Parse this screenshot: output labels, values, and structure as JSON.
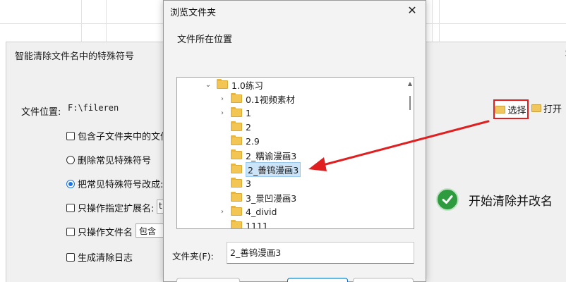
{
  "tool": {
    "title": "智能清除文件名中的特殊符号",
    "close": "×",
    "location_label": "文件位置:",
    "location_value": "F:\\fileren",
    "options": {
      "include_sub": "包含子文件夹中的文件",
      "delete_common": "删除常见特殊符号",
      "replace_common": "把常见特殊符号改成:",
      "only_ext": "只操作指定扩展名:",
      "only_ext_value": "t",
      "only_name": "只操作文件名",
      "only_name_value": "包含",
      "gen_log": "生成清除日志"
    },
    "select_label": "选择",
    "open_label": "打开",
    "start_label": "开始清除并改名"
  },
  "dialog": {
    "title": "浏览文件夹",
    "close": "✕",
    "caption": "文件所在位置",
    "tree": [
      {
        "label": "1.0练习",
        "expander": "down"
      },
      {
        "label": "0.1视频素材",
        "expander": "right"
      },
      {
        "label": "1",
        "expander": "right"
      },
      {
        "label": "2",
        "expander": "none"
      },
      {
        "label": "2.9",
        "expander": "none"
      },
      {
        "label": "2_糯谕漫画3",
        "expander": "none"
      },
      {
        "label": "2_善钨漫画3",
        "expander": "none",
        "selected": true
      },
      {
        "label": "3",
        "expander": "none"
      },
      {
        "label": "3_景凹漫画3",
        "expander": "none"
      },
      {
        "label": "4_divid",
        "expander": "right"
      },
      {
        "label": "1111",
        "expander": "none"
      }
    ],
    "folder_label": "文件夹(F):",
    "folder_value": "2_善钨漫画3"
  },
  "colors": {
    "highlight_red": "#e02020",
    "selection_blue": "#cce4f7",
    "check_green": "#2e9b3e"
  },
  "icons": {
    "select": "folder-plus-icon",
    "open": "folder-open-icon",
    "start": "checkmark-circle-icon"
  }
}
